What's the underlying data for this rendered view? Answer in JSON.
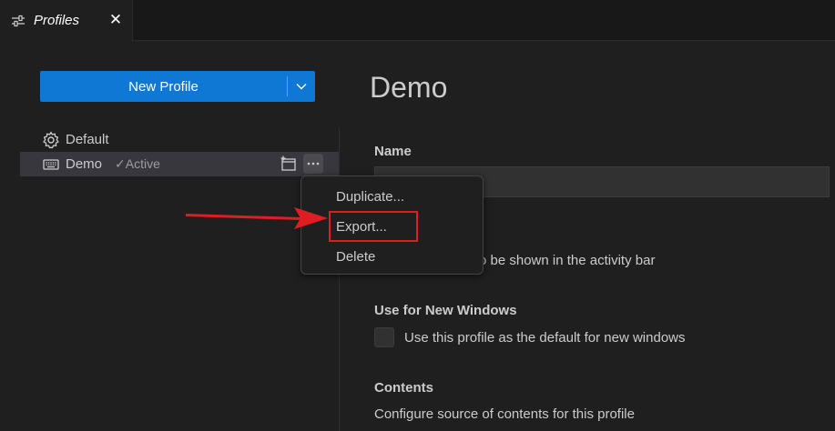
{
  "tab": {
    "label": "Profiles",
    "close_glyph": "✕",
    "icon": "settings-sliders-icon"
  },
  "toolbar": {
    "new_profile_label": "New Profile",
    "dropdown_icon": "chevron-down-icon"
  },
  "profiles": [
    {
      "label": "Default",
      "icon": "gear-icon"
    },
    {
      "label": "Demo",
      "icon": "keyboard-icon",
      "status": "✓Active"
    }
  ],
  "detail": {
    "title": "Demo",
    "name_heading": "Name",
    "name_value": "",
    "icon_text": "o be shown in the activity bar",
    "new_windows_heading": "Use for New Windows",
    "new_windows_text": "Use this profile as the default for new windows",
    "contents_heading": "Contents",
    "contents_text": "Configure source of contents for this profile"
  },
  "context_menu": {
    "items": [
      "Duplicate...",
      "Export...",
      "Delete"
    ]
  },
  "annotation": {
    "arrow_color": "#e11d24",
    "box_color": "#e11d24"
  },
  "colors": {
    "accent": "#0e78d4",
    "background": "#1f1f1f"
  }
}
